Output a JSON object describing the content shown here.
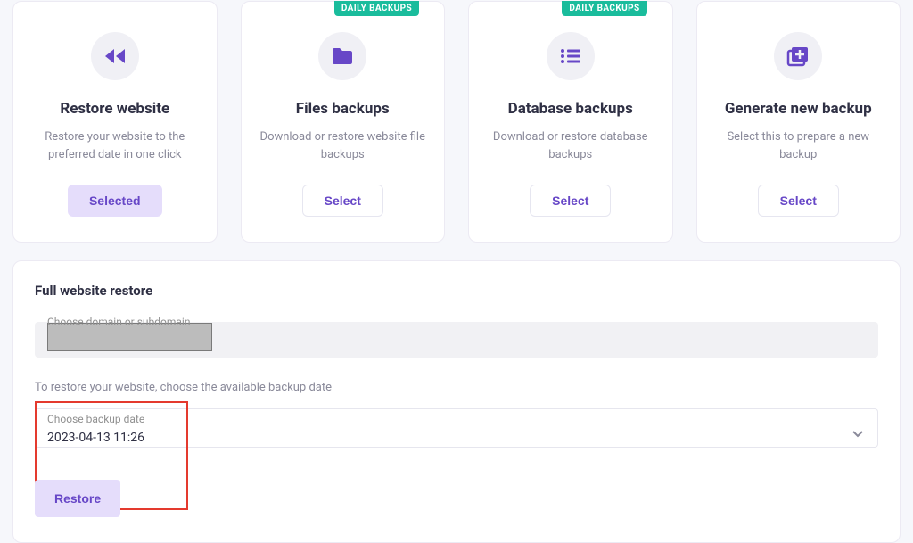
{
  "badges": {
    "daily": "DAILY BACKUPS"
  },
  "cards": [
    {
      "title": "Restore website",
      "desc": "Restore your website to the preferred date in one click",
      "button": "Selected",
      "buttonStyle": "selected"
    },
    {
      "title": "Files backups",
      "desc": "Download or restore website file backups",
      "button": "Select",
      "badge": true
    },
    {
      "title": "Database backups",
      "desc": "Download or restore database backups",
      "button": "Select",
      "badge": true
    },
    {
      "title": "Generate new backup",
      "desc": "Select this to prepare a new backup",
      "button": "Select"
    }
  ],
  "panel": {
    "title": "Full website restore",
    "domainLabel": "Choose domain or subdomain",
    "hint": "To restore your website, choose the available backup date",
    "dateLabel": "Choose backup date",
    "dateValue": "2023-04-13 11:26",
    "restoreButton": "Restore"
  }
}
